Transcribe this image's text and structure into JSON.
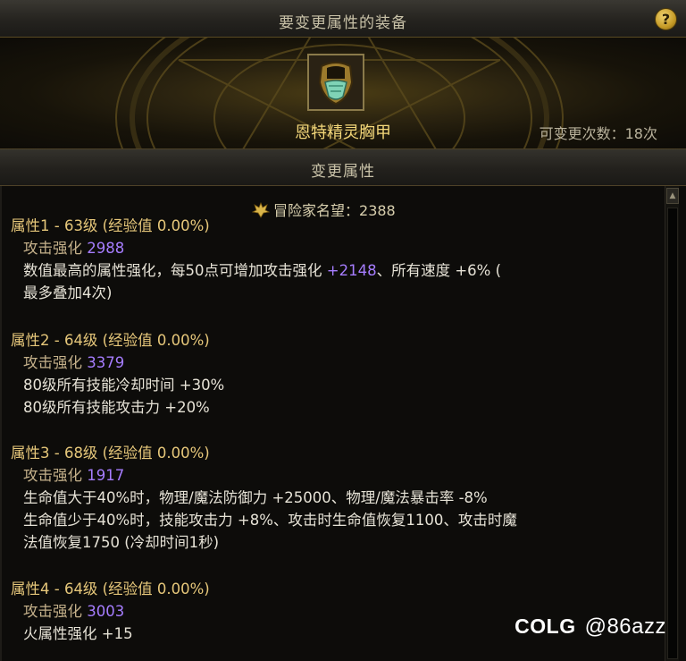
{
  "window": {
    "title": "要变更属性的装备",
    "help_label": "?"
  },
  "item": {
    "name": "恩特精灵胸甲",
    "change_count": "可变更次数：18次"
  },
  "section": {
    "title": "变更属性"
  },
  "fame": {
    "label": "冒险家名望",
    "value": "：2388"
  },
  "attributes": [
    {
      "header": "属性1 - 63级 (经验值 0.00%)",
      "stat_label": "攻击强化",
      "stat_value": "2988",
      "lines": [
        {
          "a": "数值最高的属性强化，每50点可增加攻击强化 ",
          "b": "+2148",
          "c": "、所有速度 +6% ("
        },
        {
          "a": "最多叠加4次)",
          "b": "",
          "c": ""
        }
      ]
    },
    {
      "header": "属性2 - 64级 (经验值 0.00%)",
      "stat_label": "攻击强化",
      "stat_value": "3379",
      "lines": [
        {
          "a": "80级所有技能冷却时间 +30%",
          "b": "",
          "c": ""
        },
        {
          "a": "80级所有技能攻击力 +20%",
          "b": "",
          "c": ""
        }
      ]
    },
    {
      "header": "属性3 - 68级 (经验值 0.00%)",
      "stat_label": "攻击强化",
      "stat_value": "1917",
      "lines": [
        {
          "a": "生命值大于40%时，物理/魔法防御力 +25000、物理/魔法暴击率 -8%",
          "b": "",
          "c": ""
        },
        {
          "a": "生命值少于40%时，技能攻击力 +8%、攻击时生命值恢复1100、攻击时魔",
          "b": "",
          "c": ""
        },
        {
          "a": "法值恢复1750 (冷却时间1秒)",
          "b": "",
          "c": ""
        }
      ]
    },
    {
      "header": "属性4 - 64级 (经验值 0.00%)",
      "stat_label": "攻击强化",
      "stat_value": "3003",
      "lines": [
        {
          "a": "火属性强化 +15",
          "b": "",
          "c": ""
        }
      ]
    }
  ],
  "scroll": {
    "up_icon": "▲"
  },
  "watermark": {
    "logo": "COLG",
    "handle": "@86azz"
  },
  "colors": {
    "gold_title": "#f3d77a",
    "attr_header": "#e6c77a",
    "stat_purple": "#a67dff",
    "body_text": "#e6e2d6"
  }
}
